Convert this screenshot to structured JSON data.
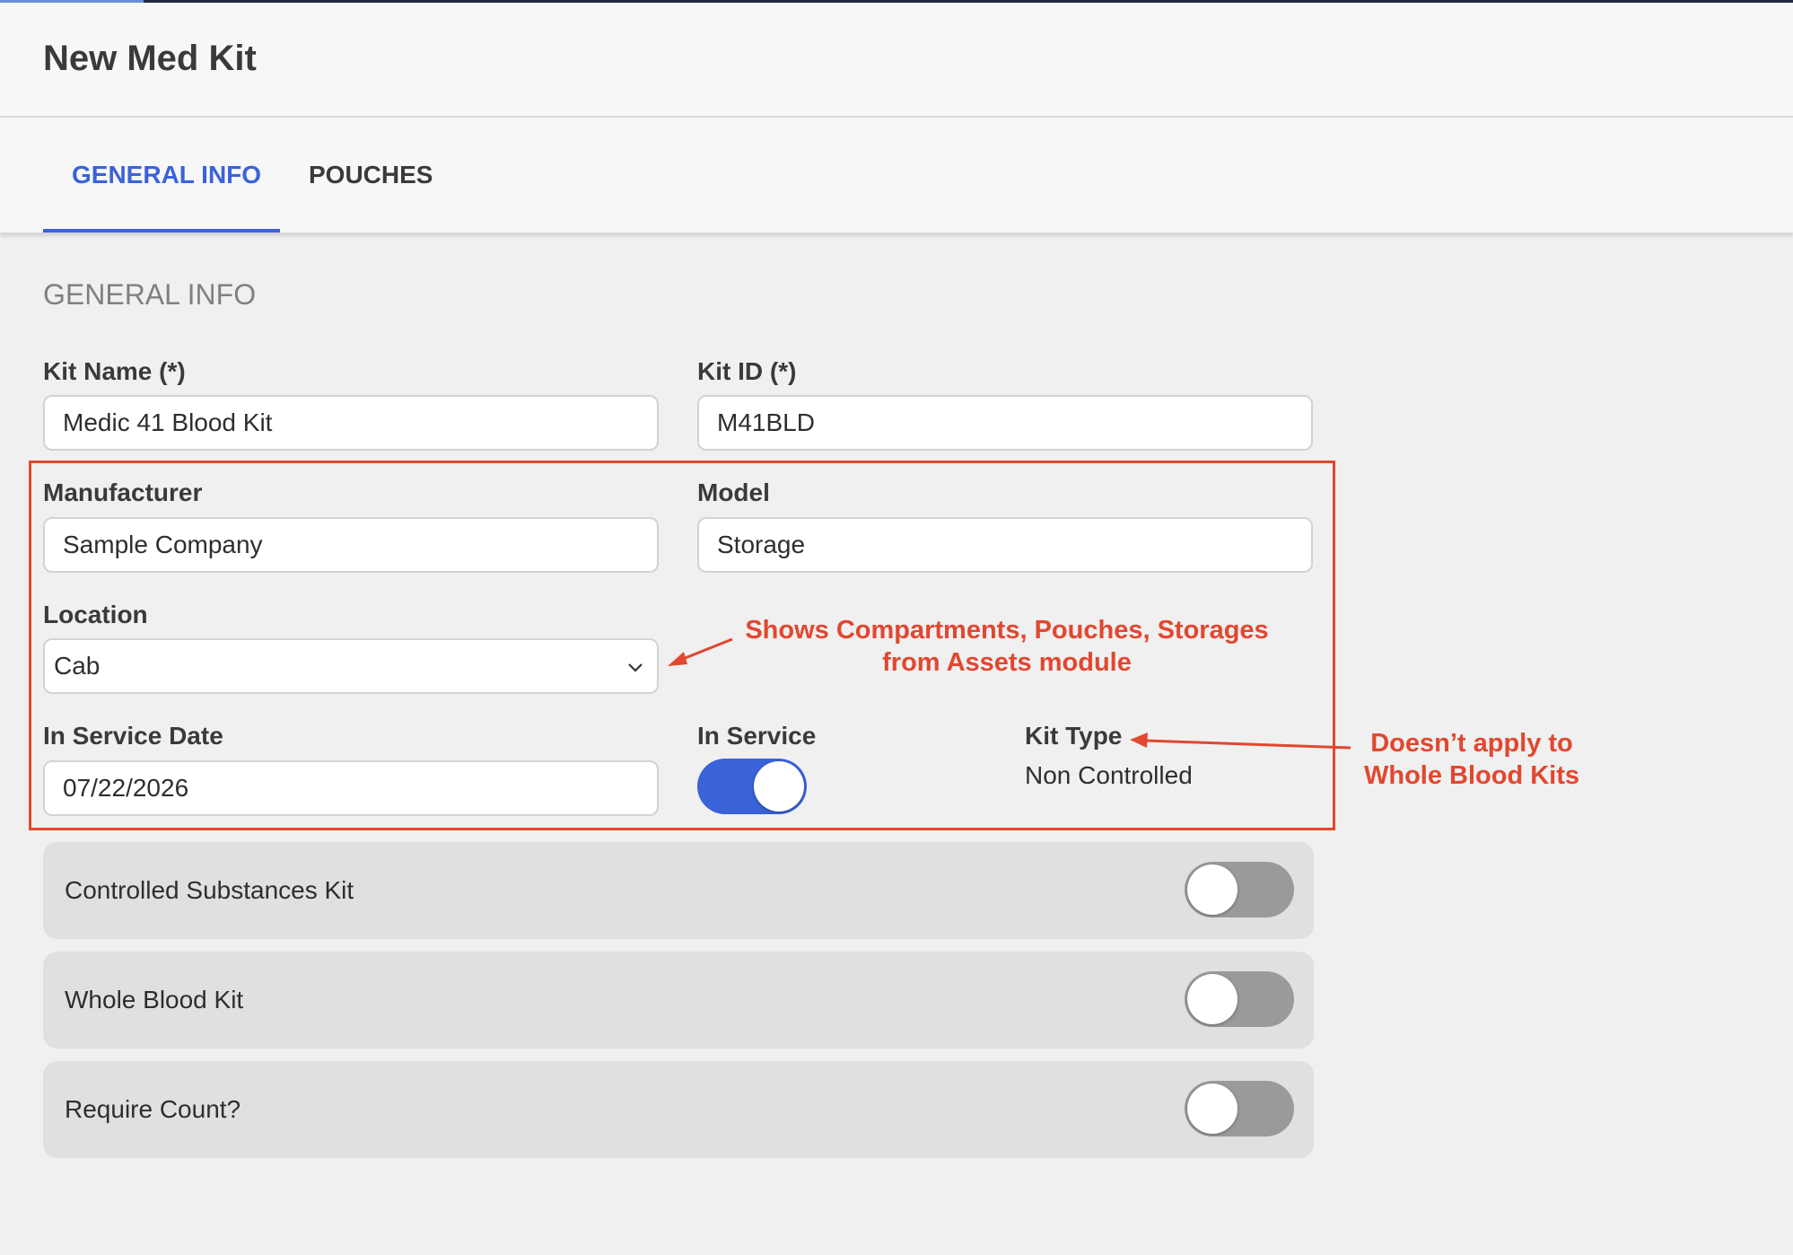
{
  "header": {
    "title": "New Med Kit"
  },
  "tabs": [
    {
      "label": "GENERAL INFO",
      "active": true
    },
    {
      "label": "POUCHES",
      "active": false
    }
  ],
  "section": {
    "title": "GENERAL INFO"
  },
  "form": {
    "kit_name": {
      "label": "Kit Name (*)",
      "value": "Medic 41 Blood Kit"
    },
    "kit_id": {
      "label": "Kit ID (*)",
      "value": "M41BLD"
    },
    "manufacturer": {
      "label": "Manufacturer",
      "value": "Sample Company"
    },
    "model": {
      "label": "Model",
      "value": "Storage"
    },
    "location": {
      "label": "Location",
      "value": "Cab"
    },
    "in_service_date": {
      "label": "In Service Date",
      "value": "07/22/2026"
    },
    "in_service": {
      "label": "In Service",
      "on": true
    },
    "kit_type": {
      "label": "Kit Type",
      "value": "Non Controlled"
    }
  },
  "toggles": [
    {
      "label": "Controlled Substances Kit",
      "on": false
    },
    {
      "label": "Whole Blood Kit",
      "on": false
    },
    {
      "label": "Require Count?",
      "on": false
    }
  ],
  "annotations": {
    "location_note_line1": "Shows Compartments, Pouches, Storages",
    "location_note_line2": "from Assets module",
    "kit_type_note_line1": "Doesn’t apply to",
    "kit_type_note_line2": "Whole Blood Kits"
  },
  "colors": {
    "accent": "#3a63d8",
    "annotation": "#e2472f",
    "toggle_off": "#9a9a9a"
  }
}
